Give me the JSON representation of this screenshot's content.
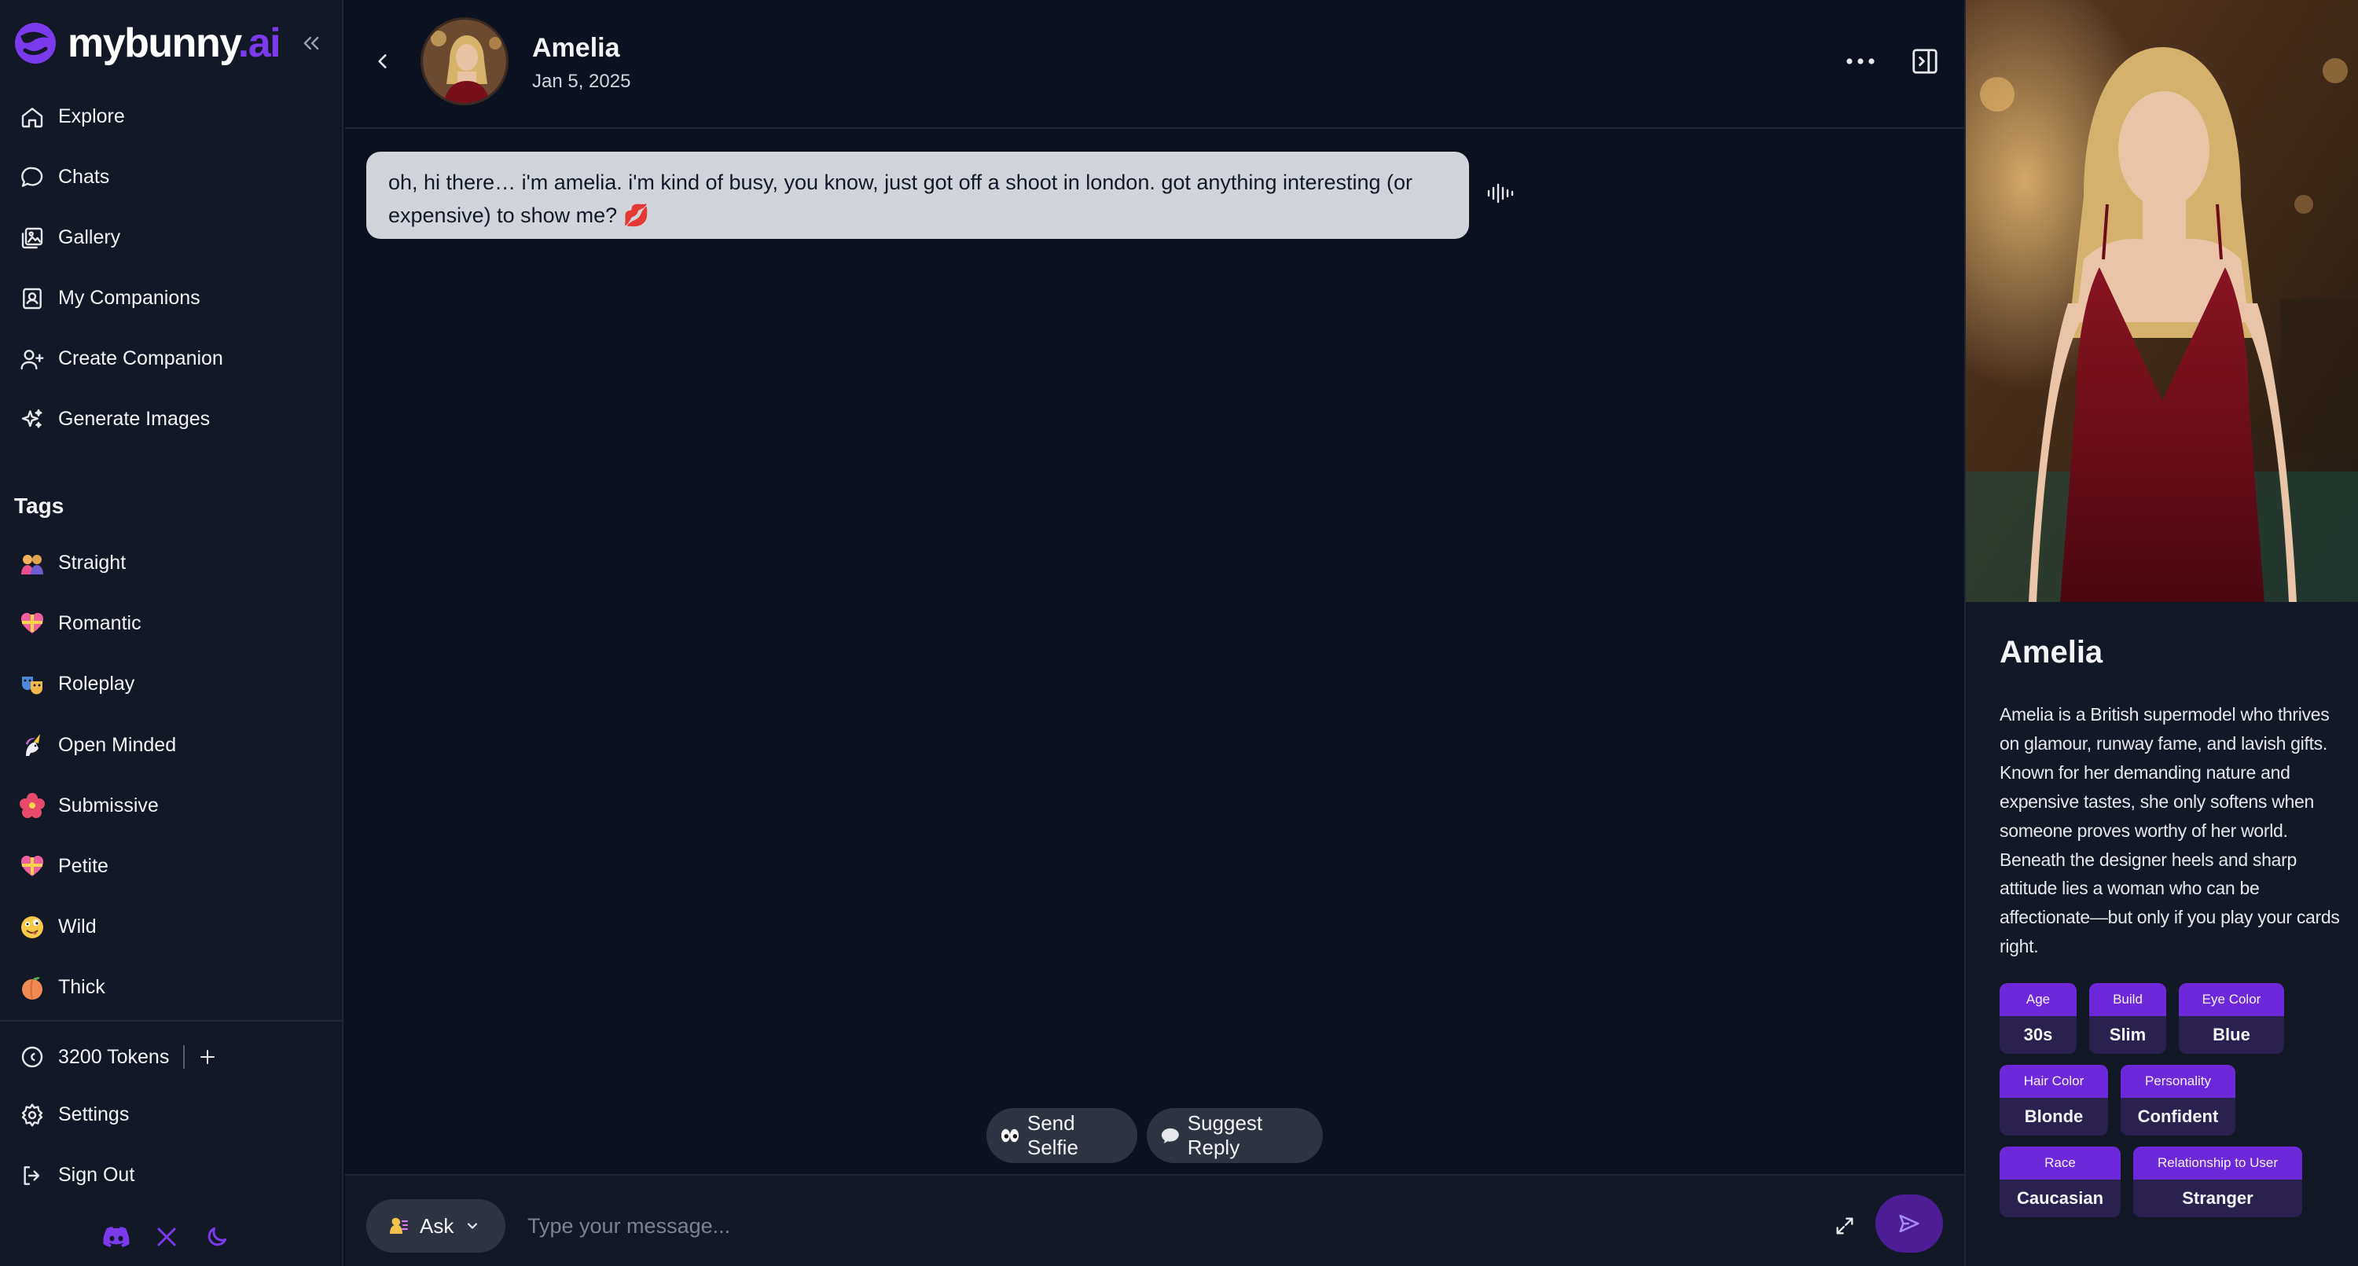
{
  "brand": {
    "name_main": "mybunny",
    "name_suffix": ".ai",
    "accent": "#7c3aed"
  },
  "sidebar": {
    "nav": [
      {
        "label": "Explore",
        "icon": "home-icon"
      },
      {
        "label": "Chats",
        "icon": "chat-bubble-icon"
      },
      {
        "label": "Gallery",
        "icon": "gallery-icon"
      },
      {
        "label": "My Companions",
        "icon": "contact-card-icon"
      },
      {
        "label": "Create Companion",
        "icon": "user-plus-icon"
      },
      {
        "label": "Generate Images",
        "icon": "sparkles-icon"
      }
    ],
    "tags_title": "Tags",
    "tags": [
      {
        "label": "Straight",
        "emoji": "💑"
      },
      {
        "label": "Romantic",
        "emoji": "💝"
      },
      {
        "label": "Roleplay",
        "emoji": "🎭"
      },
      {
        "label": "Open Minded",
        "emoji": "🦄"
      },
      {
        "label": "Submissive",
        "emoji": "🌺"
      },
      {
        "label": "Petite",
        "emoji": "💝"
      },
      {
        "label": "Wild",
        "emoji": "🤪"
      },
      {
        "label": "Thick",
        "emoji": "🍑"
      }
    ],
    "tokens_label": "3200 Tokens",
    "settings_label": "Settings",
    "signout_label": "Sign Out",
    "social": [
      "discord-icon",
      "x-icon",
      "moon-icon"
    ]
  },
  "chat": {
    "name": "Amelia",
    "date": "Jan 5, 2025",
    "message": "oh, hi there… i'm amelia. i'm kind of busy, you know, just got off a shoot in london. got anything interesting (or expensive) to show me? 💋",
    "send_selfie_label": "Send Selfie",
    "suggest_reply_label": "Suggest Reply",
    "ask_label": "Ask",
    "input_placeholder": "Type your message..."
  },
  "profile": {
    "name": "Amelia",
    "description": "Amelia is a British supermodel who thrives on glamour, runway fame, and lavish gifts. Known for her demanding nature and expensive tastes, she only softens when someone proves worthy of her world. Beneath the designer heels and sharp attitude lies a woman who can be affectionate—but only if you play your cards right.",
    "attributes": [
      {
        "key": "Age",
        "value": "30s"
      },
      {
        "key": "Build",
        "value": "Slim"
      },
      {
        "key": "Eye Color",
        "value": "Blue"
      },
      {
        "key": "Hair Color",
        "value": "Blonde"
      },
      {
        "key": "Personality",
        "value": "Confident"
      },
      {
        "key": "Race",
        "value": "Caucasian"
      },
      {
        "key": "Relationship to User",
        "value": "Stranger"
      }
    ]
  }
}
